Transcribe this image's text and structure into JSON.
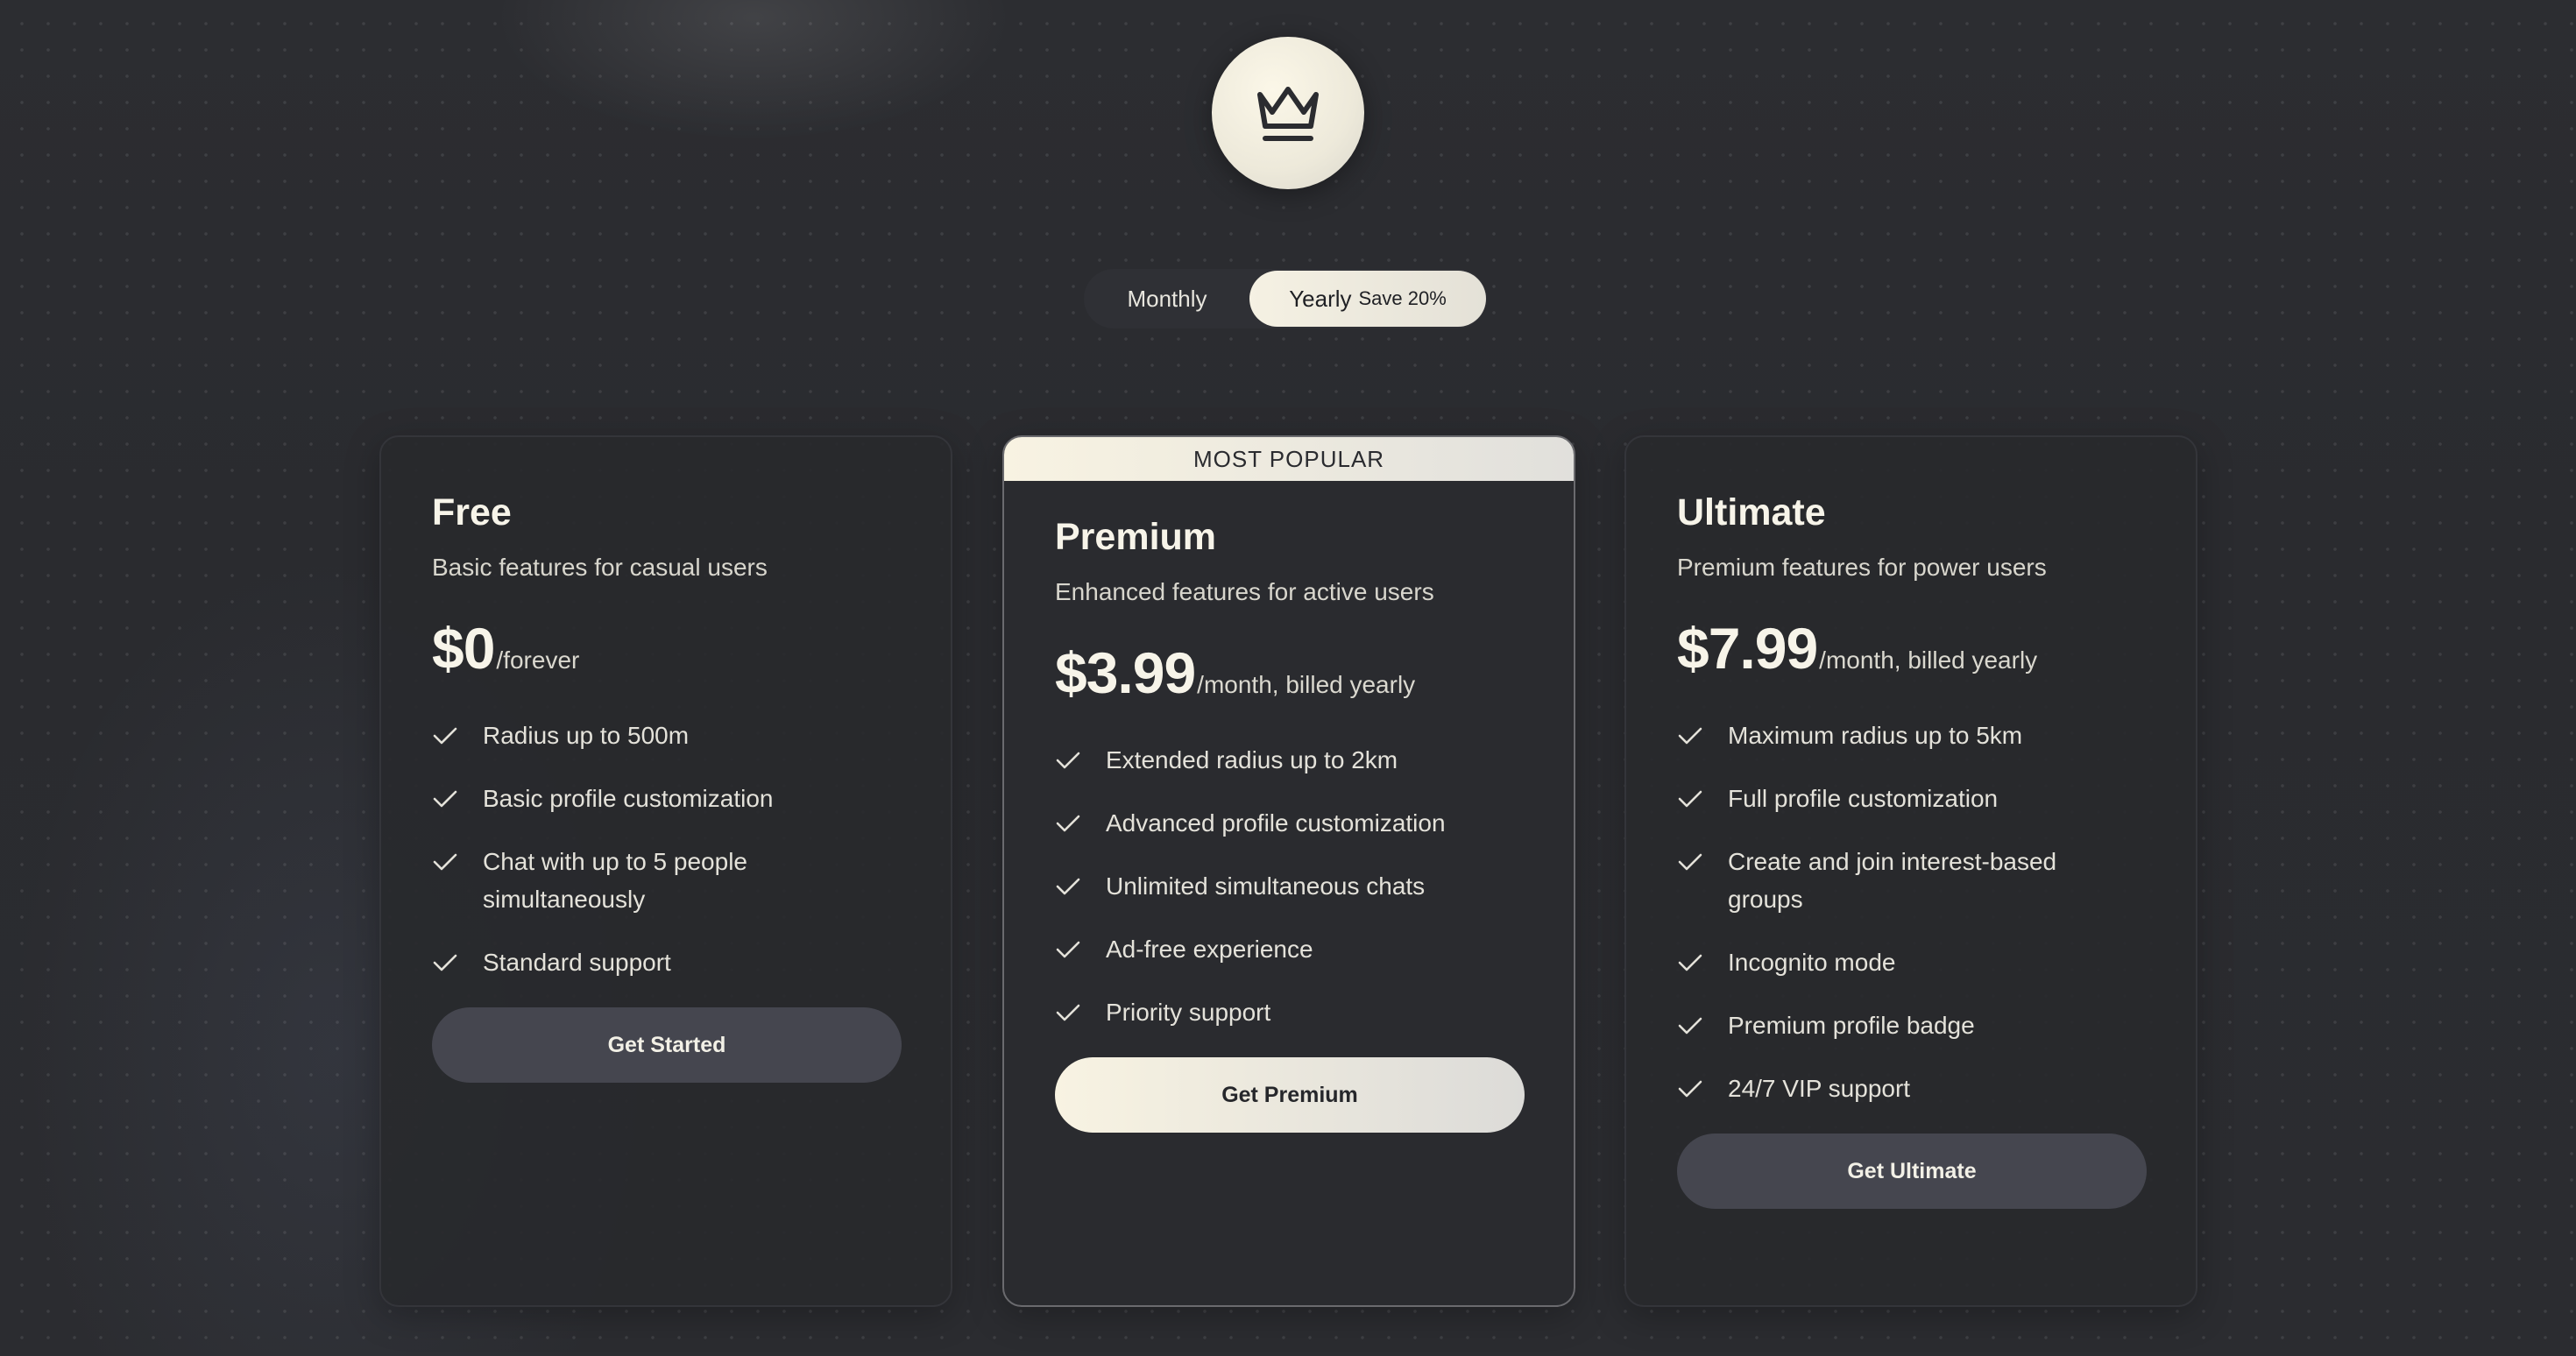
{
  "toggle": {
    "monthly": "Monthly",
    "yearly": "Yearly",
    "yearly_badge": "Save 20%",
    "selected": "yearly"
  },
  "plans": [
    {
      "name": "Free",
      "description": "Basic features for casual users",
      "price": "$0",
      "period": "/forever",
      "features": [
        "Radius up to 500m",
        "Basic profile customization",
        "Chat with up to 5 people simultaneously",
        "Standard support"
      ],
      "cta": "Get Started"
    },
    {
      "badge": "MOST POPULAR",
      "name": "Premium",
      "description": "Enhanced features for active users",
      "price": "$3.99",
      "period": "/month, billed yearly",
      "features": [
        "Extended radius up to 2km",
        "Advanced profile customization",
        "Unlimited simultaneous chats",
        "Ad-free experience",
        "Priority support"
      ],
      "cta": "Get Premium"
    },
    {
      "name": "Ultimate",
      "description": "Premium features for power users",
      "price": "$7.99",
      "period": "/month, billed yearly",
      "features": [
        "Maximum radius up to 5km",
        "Full profile customization",
        "Create and join interest-based groups",
        "Incognito mode",
        "Premium profile badge",
        "24/7 VIP support"
      ],
      "cta": "Get Ultimate"
    }
  ],
  "icons": {
    "logo": "crown-icon",
    "feature": "check-icon"
  },
  "colors": {
    "background": "#2b2c30",
    "card": "#28292d",
    "accent_light": "#f5f1e3",
    "button_dark": "#45464f"
  }
}
